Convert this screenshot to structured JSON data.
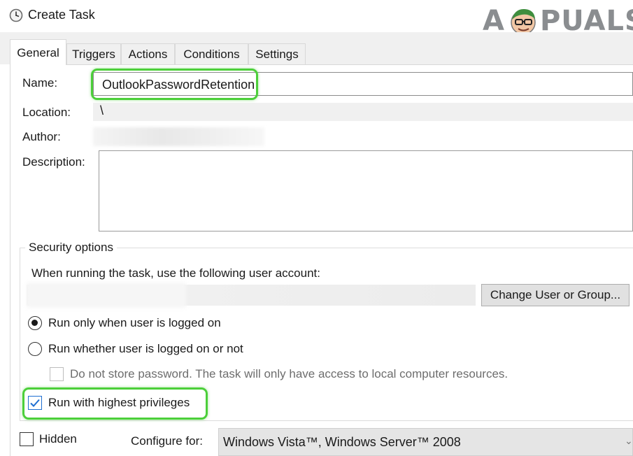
{
  "window": {
    "title": "Create Task",
    "icon": "clock-icon"
  },
  "watermark": {
    "text_left": "A",
    "text_right": "PUALS",
    "icon": "mascot-face-icon"
  },
  "tabs": [
    {
      "label": "General",
      "active": true
    },
    {
      "label": "Triggers",
      "active": false
    },
    {
      "label": "Actions",
      "active": false
    },
    {
      "label": "Conditions",
      "active": false
    },
    {
      "label": "Settings",
      "active": false
    }
  ],
  "general": {
    "name_label": "Name:",
    "name_value": "OutlookPasswordRetention",
    "location_label": "Location:",
    "location_value": "\\",
    "author_label": "Author:",
    "description_label": "Description:",
    "description_value": ""
  },
  "security": {
    "legend": "Security options",
    "account_prompt": "When running the task, use the following user account:",
    "change_button": "Change User or Group...",
    "radio_logged_on": {
      "label": "Run only when user is logged on",
      "checked": true
    },
    "radio_whether": {
      "label": "Run whether user is logged on or not",
      "checked": false
    },
    "no_store_password": {
      "label": "Do not store password.  The task will only have access to local computer resources.",
      "checked": false,
      "disabled": true
    },
    "highest_privileges": {
      "label": "Run with highest privileges",
      "checked": true
    }
  },
  "bottom": {
    "hidden": {
      "label": "Hidden",
      "checked": false
    },
    "configure_label": "Configure for:",
    "configure_value": "Windows Vista™, Windows Server™ 2008"
  },
  "colors": {
    "highlight": "#4ccf3a",
    "check_accent": "#1f6fd1",
    "tab_bg": "#f0f0f0"
  }
}
